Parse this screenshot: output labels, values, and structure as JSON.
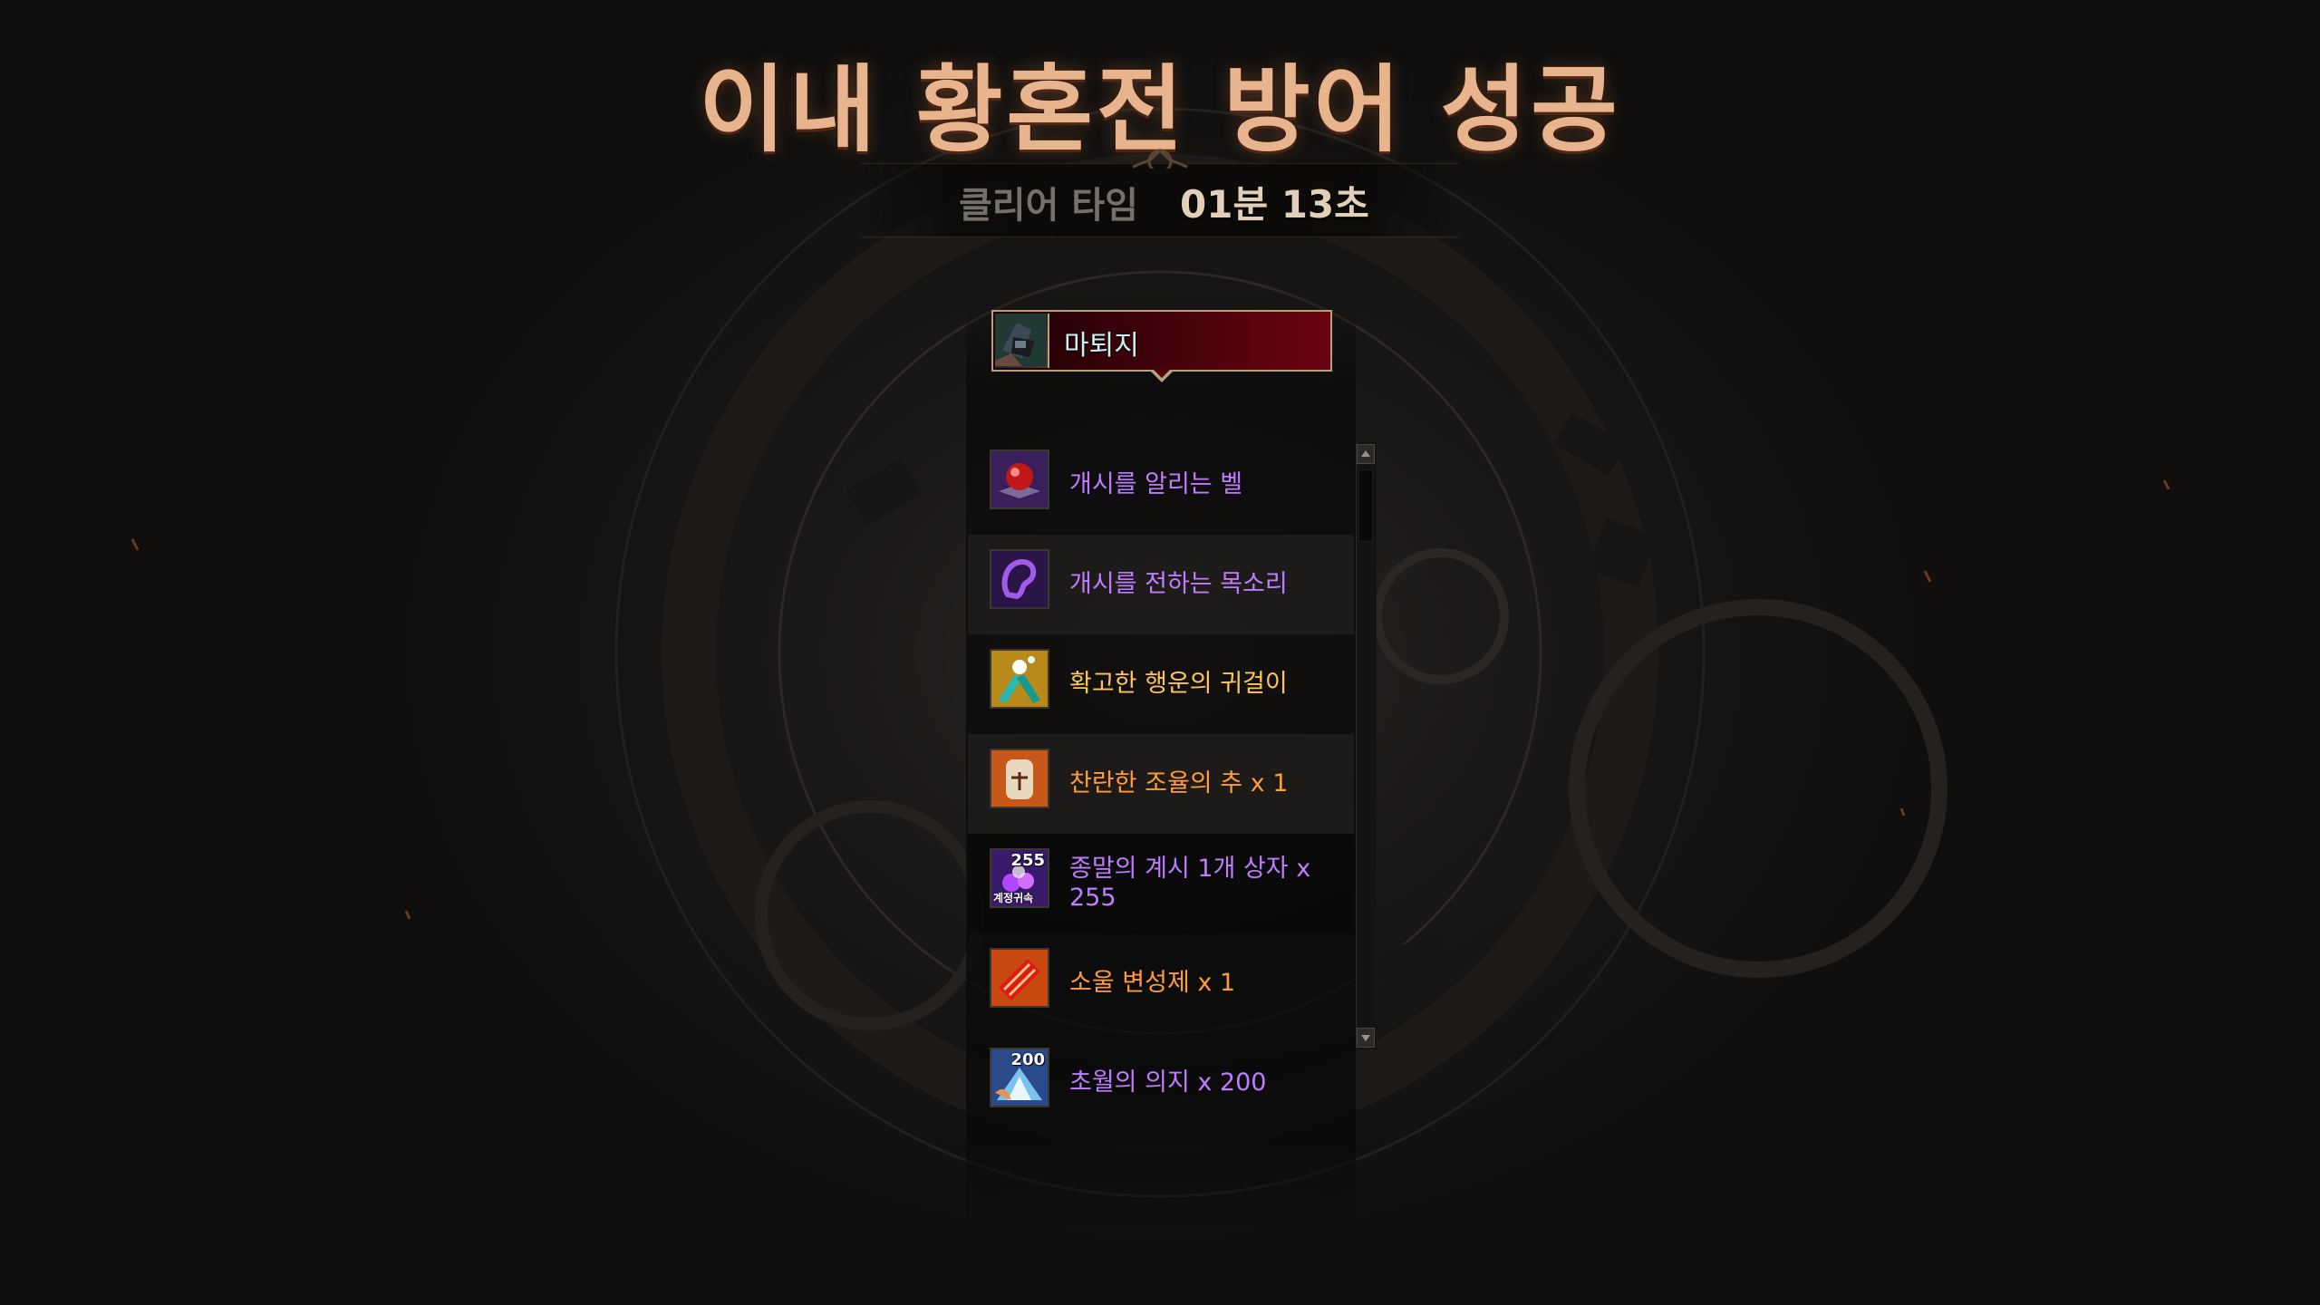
{
  "result": {
    "title": "이내 황혼전 방어 성공",
    "clear_time_label": "클리어 타임",
    "clear_time_value": "01분 13초"
  },
  "player": {
    "name": "마퇴지"
  },
  "rewards": [
    {
      "label": "개시를 알리는 벨",
      "color": "#bf7cff",
      "icon": "red-orb-bell-icon"
    },
    {
      "label": "개시를 전하는 목소리",
      "color": "#bf7cff",
      "icon": "purple-ear-voice-icon"
    },
    {
      "label": "확고한 행운의 귀걸이",
      "color": "#ffc45c",
      "icon": "fly-earring-icon"
    },
    {
      "label": "찬란한 조율의 추 x 1",
      "color": "#ff9b3a",
      "icon": "scale-jar-icon"
    },
    {
      "label": "종말의 계시 1개 상자 x 255",
      "color": "#bf7cff",
      "icon": "purple-gem-box-icon",
      "badge": "255",
      "sub": "계정귀속"
    },
    {
      "label": "소울 변성제 x 1",
      "color": "#ff9b3a",
      "icon": "red-scroll-icon"
    },
    {
      "label": "초월의 의지 x 200",
      "color": "#bf7cff",
      "icon": "blue-light-icon",
      "badge": "200"
    }
  ]
}
